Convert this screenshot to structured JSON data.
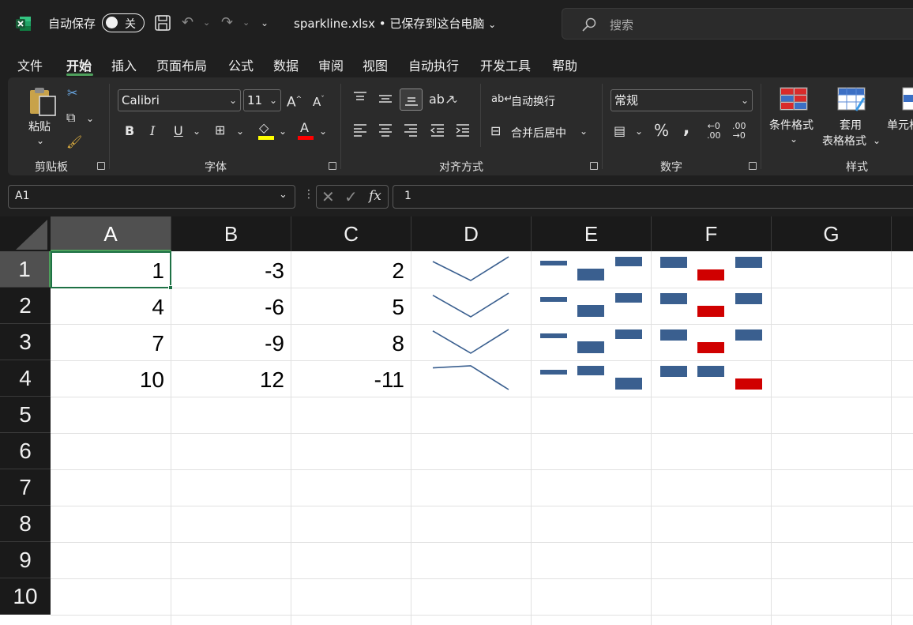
{
  "titlebar": {
    "autosave_label": "自动保存",
    "autosave_state": "关",
    "filename": "sparkline.xlsx",
    "save_status": "• 已保存到这台电脑",
    "search_placeholder": "搜索"
  },
  "menu": {
    "tabs": [
      "文件",
      "开始",
      "插入",
      "页面布局",
      "公式",
      "数据",
      "审阅",
      "视图",
      "自动执行",
      "开发工具",
      "帮助"
    ],
    "active_tab": "开始"
  },
  "ribbon": {
    "clipboard": {
      "paste_label": "粘贴",
      "group_label": "剪贴板"
    },
    "font": {
      "font_name": "Calibri",
      "font_size": "11",
      "group_label": "字体",
      "fill_color": "#ffff00",
      "font_color": "#ff0000"
    },
    "alignment": {
      "wrap_text": "自动换行",
      "merge_center": "合并后居中",
      "group_label": "对齐方式"
    },
    "number": {
      "format": "常规",
      "group_label": "数字"
    },
    "styles": {
      "conditional_format": "条件格式",
      "format_table_1": "套用",
      "format_table_2": "表格格式",
      "cell_styles": "单元格",
      "group_label": "样式"
    }
  },
  "formula_bar": {
    "name_box": "A1",
    "formula": "1"
  },
  "sheet": {
    "columns": [
      "A",
      "B",
      "C",
      "D",
      "E",
      "F",
      "G"
    ],
    "selected_column": "A",
    "rows": [
      "1",
      "2",
      "3",
      "4",
      "5",
      "6",
      "7",
      "8",
      "9",
      "10"
    ],
    "selected_row": "1",
    "cells": [
      [
        "1",
        "-3",
        "2"
      ],
      [
        "4",
        "-6",
        "5"
      ],
      [
        "7",
        "-9",
        "8"
      ],
      [
        "10",
        "12",
        "-11"
      ]
    ],
    "sparklines": {
      "data": [
        [
          1,
          -3,
          2
        ],
        [
          4,
          -6,
          5
        ],
        [
          7,
          -9,
          8
        ],
        [
          10,
          12,
          -11
        ]
      ],
      "line_color": "#3a5f8f",
      "column_color": "#3a5f8f",
      "negative_color": "#d00000"
    }
  },
  "colors": {
    "accent": "#4ea05c",
    "active_cell_border": "#1e7145"
  }
}
